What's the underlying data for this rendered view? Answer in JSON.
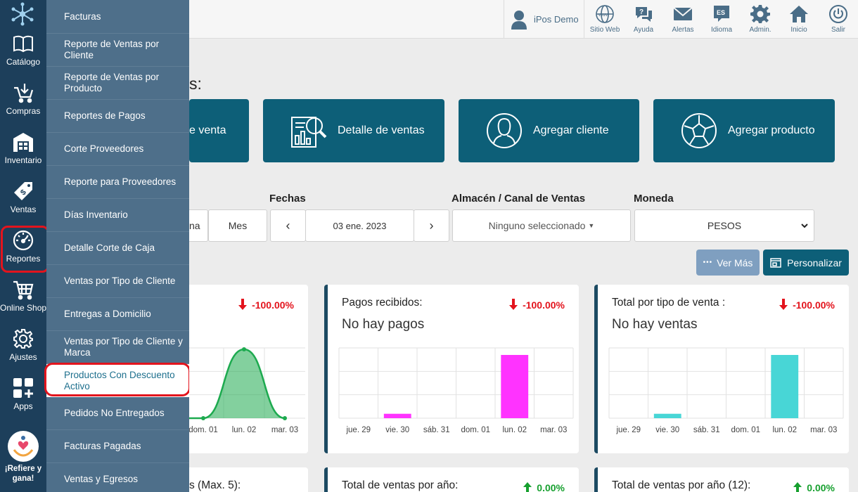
{
  "sidebar": {
    "items": [
      {
        "label": "Catálogo",
        "icon": "book-icon"
      },
      {
        "label": "Compras",
        "icon": "cart-download-icon"
      },
      {
        "label": "Inventario",
        "icon": "warehouse-icon"
      },
      {
        "label": "Ventas",
        "icon": "price-tag-icon"
      },
      {
        "label": "Reportes",
        "icon": "gauge-icon"
      },
      {
        "label": "Online Shop",
        "icon": "shopping-cart-icon"
      },
      {
        "label": "Ajustes",
        "icon": "gear-icon"
      },
      {
        "label": "Apps",
        "icon": "apps-grid-icon"
      },
      {
        "label": "¡Refiere y gana!",
        "icon": "referral-icon"
      }
    ],
    "active": "Reportes"
  },
  "menu": {
    "items": [
      "Facturas",
      "Reporte de Ventas por Cliente",
      "Reporte de Ventas por Producto",
      "Reportes de Pagos",
      "Corte Proveedores",
      "Reporte para Proveedores",
      "Días Inventario",
      "Detalle Corte de Caja",
      "Ventas por Tipo de Cliente",
      "Entregas a Domicilio",
      "Ventas por Tipo de Cliente y Marca",
      "Productos Con Descuento Activo",
      "Pedidos No Entregados",
      "Facturas Pagadas",
      "Ventas y Egresos"
    ],
    "highlighted": "Productos Con Descuento Activo"
  },
  "topbar": {
    "user": "iPos Demo",
    "items": [
      {
        "label": "Sitio Web",
        "icon": "globe-icon"
      },
      {
        "label": "Ayuda",
        "icon": "help-chat-icon"
      },
      {
        "label": "Alertas",
        "icon": "envelope-icon"
      },
      {
        "label": "Idioma",
        "icon": "language-icon",
        "badge": "ES"
      },
      {
        "label": "Admin.",
        "icon": "settings-icon"
      },
      {
        "label": "Inicio",
        "icon": "home-icon"
      },
      {
        "label": "Salir",
        "icon": "power-icon"
      }
    ]
  },
  "page": {
    "heading_fragment": "s:"
  },
  "quick_actions": [
    {
      "label": "e venta"
    },
    {
      "label": "Detalle de ventas",
      "icon": "sales-report-icon"
    },
    {
      "label": "Agregar cliente",
      "icon": "user-outline-icon"
    },
    {
      "label": "Agregar producto",
      "icon": "soccer-ball-icon"
    }
  ],
  "filters": {
    "range_partial": "na",
    "range_month": "Mes",
    "dates_label": "Fechas",
    "date_value": "03 ene. 2023",
    "prev": "‹",
    "next": "›",
    "warehouse_label": "Almacén / Canal de Ventas",
    "warehouse_value": "Ninguno seleccionado",
    "currency_label": "Moneda",
    "currency_value": "PESOS"
  },
  "buttons": {
    "more": "Ver Más",
    "customize": "Personalizar"
  },
  "colors": {
    "rail": "#1d3f5b",
    "drawer": "#4e6f8a",
    "accent": "#0d5f78",
    "danger": "#e3141d",
    "success": "#17a02f"
  },
  "cards": {
    "c1": {
      "pct": "-100.00%"
    },
    "c2": {
      "title": "Pagos recibidos:",
      "sub": "No hay pagos",
      "pct": "-100.00%"
    },
    "c3": {
      "title": "Total por tipo de venta :",
      "sub": "No hay ventas",
      "pct": "-100.00%"
    },
    "c4": {
      "title_partial": "s (Max. 5):"
    },
    "c5": {
      "title": "Total de ventas por año:",
      "pct": "0.00%"
    },
    "c6": {
      "title": "Total de ventas por año (12):",
      "pct": "0.00%"
    }
  },
  "chart_data": [
    {
      "type": "area",
      "x_visible": [
        "dom. 01",
        "lun. 02",
        "mar. 03"
      ],
      "values": [
        0,
        1,
        0
      ],
      "color": "#1daa4f",
      "ylim": [
        0,
        1
      ],
      "grid": true
    },
    {
      "type": "bar",
      "categories": [
        "jue. 29",
        "vie. 30",
        "sáb. 31",
        "dom. 01",
        "lun. 02",
        "mar. 03"
      ],
      "values": [
        0,
        0.07,
        0,
        0,
        1,
        0
      ],
      "color": "#ff33ff",
      "ylim": [
        0,
        1
      ],
      "grid": true
    },
    {
      "type": "bar",
      "categories": [
        "jue. 29",
        "vie. 30",
        "sáb. 31",
        "dom. 01",
        "lun. 02",
        "mar. 03"
      ],
      "values": [
        0,
        0.07,
        0,
        0,
        1,
        0
      ],
      "color": "#48d6d6",
      "ylim": [
        0,
        1
      ],
      "grid": true
    }
  ]
}
